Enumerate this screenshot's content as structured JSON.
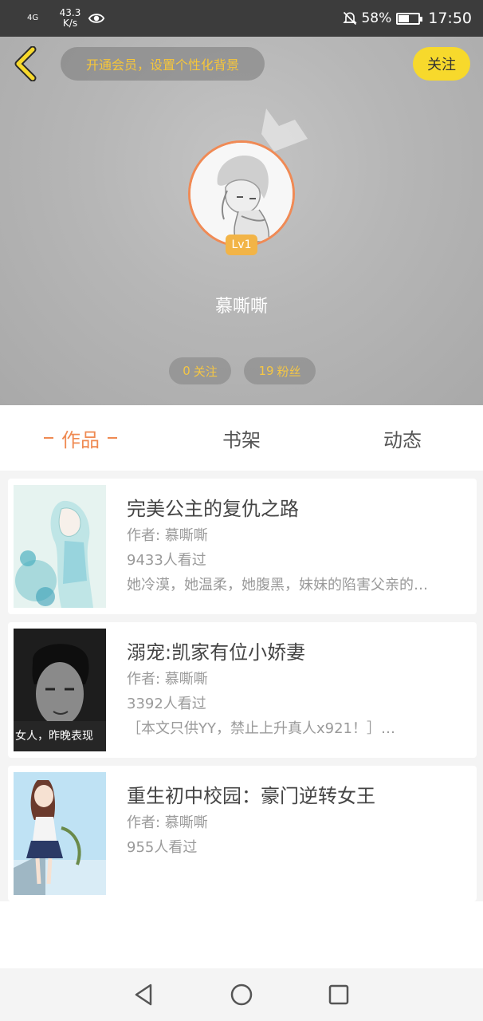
{
  "status_bar": {
    "signal": "4G",
    "speed_value": "43.3",
    "speed_unit": "K/s",
    "battery": "58%",
    "battery_level": 0.58,
    "time": "17:50"
  },
  "header": {
    "vip_prompt": "开通会员，设置个性化背景",
    "follow_label": "关注",
    "level": "Lv1",
    "username": "慕嘶嘶",
    "following_count": "0",
    "following_label": "关注",
    "fans_count": "19",
    "fans_label": "粉丝"
  },
  "tabs": [
    {
      "label": "作品",
      "active": true
    },
    {
      "label": "书架",
      "active": false
    },
    {
      "label": "动态",
      "active": false
    }
  ],
  "books": [
    {
      "title": "完美公主的复仇之路",
      "author": "作者: 慕嘶嘶",
      "views": "9433人看过",
      "desc": "她冷漠，她温柔，她腹黑，妹妹的陷害父亲的…"
    },
    {
      "title": "溺宠:凯家有位小娇妻",
      "author": "作者: 慕嘶嘶",
      "views": "3392人看过",
      "desc": "［本文只供YY，禁止上升真人x921！］…",
      "cover_text": "女人，昨晚表现"
    },
    {
      "title": "重生初中校园：豪门逆转女王",
      "author": "作者: 慕嘶嘶",
      "views": "955人看过",
      "desc": ""
    }
  ],
  "colors": {
    "accent": "#ef8a52",
    "follow_yellow": "#f7d92c",
    "stat_text": "#f4c645"
  }
}
